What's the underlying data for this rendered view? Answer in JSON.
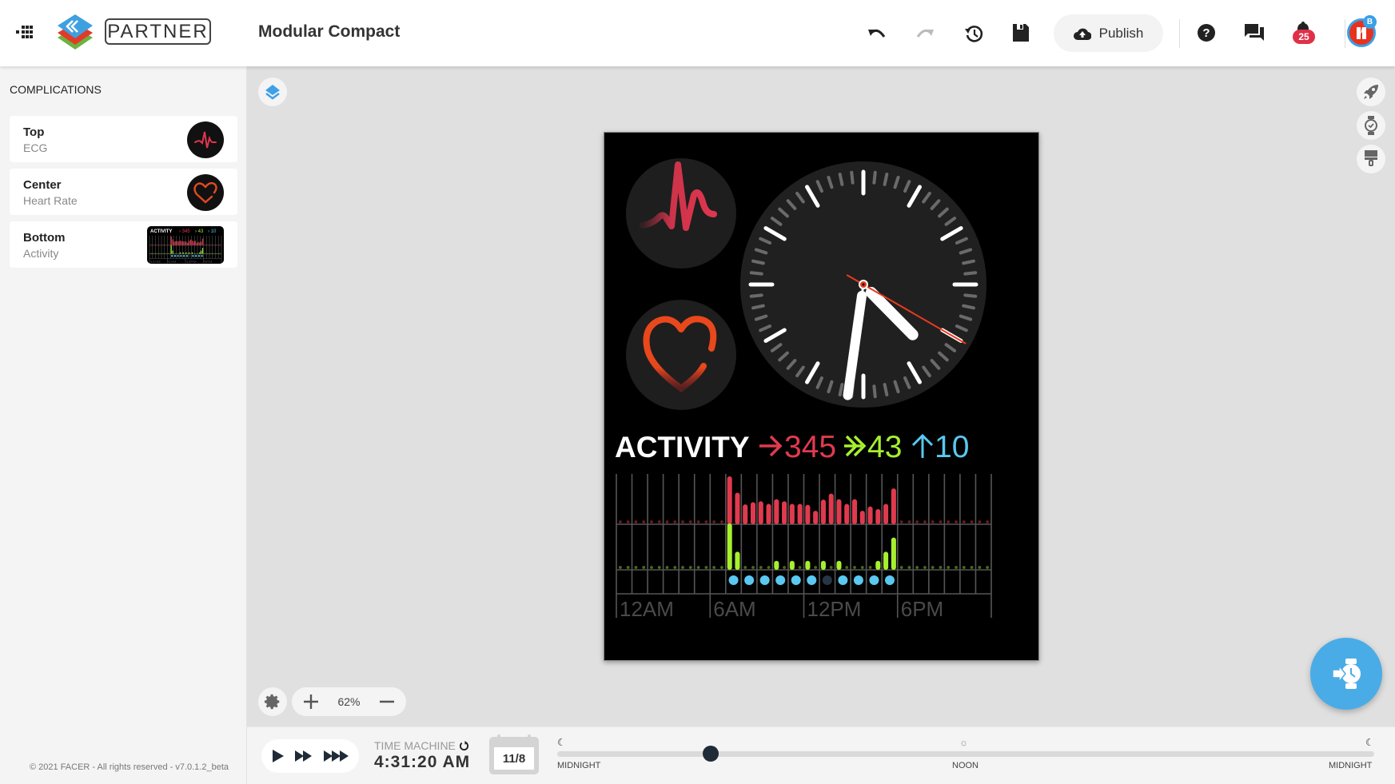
{
  "header": {
    "brand_badge": "PARTNER",
    "title": "Modular Compact",
    "publish_label": "Publish",
    "notification_count": "25",
    "avatar_badge": "B"
  },
  "sidebar": {
    "title": "COMPLICATIONS",
    "items": [
      {
        "slot": "Top",
        "type": "ECG"
      },
      {
        "slot": "Center",
        "type": "Heart Rate"
      },
      {
        "slot": "Bottom",
        "type": "Activity"
      }
    ],
    "footer": "© 2021 FACER - All rights reserved - v7.0.1.2_beta"
  },
  "canvas": {
    "zoom_level": "62%"
  },
  "watch_face": {
    "time": {
      "hour": 4,
      "minute": 31,
      "second": 20
    },
    "activity": {
      "label": "ACTIVITY",
      "move": "345",
      "exercise": "43",
      "stand": "10",
      "colors": {
        "move": "#e03a4e",
        "exercise": "#a6f02e",
        "stand": "#5ac8f0"
      },
      "hour_labels": [
        "12AM",
        "6AM",
        "12PM",
        "6PM"
      ],
      "move_bars": [
        0,
        0,
        0,
        0,
        0,
        0,
        0,
        0,
        0,
        0,
        0,
        0,
        0,
        0,
        1.0,
        0.62,
        0.35,
        0.4,
        0.42,
        0.36,
        0.47,
        0.42,
        0.36,
        0.36,
        0.34,
        0.2,
        0.46,
        0.6,
        0.47,
        0.36,
        0.47,
        0.2,
        0.3,
        0.24,
        0.36,
        0.72,
        0,
        0,
        0,
        0,
        0,
        0,
        0,
        0,
        0,
        0,
        0,
        0
      ],
      "exercise_bars": [
        0,
        0,
        0,
        0,
        0,
        0,
        0,
        0,
        0,
        0,
        0,
        0,
        0,
        0,
        1.0,
        0.32,
        0,
        0,
        0,
        0,
        0.1,
        0,
        0.1,
        0,
        0.1,
        0,
        0.1,
        0,
        0.1,
        0,
        0,
        0,
        0,
        0.1,
        0.32,
        0.66,
        0,
        0,
        0,
        0,
        0,
        0,
        0,
        0,
        0,
        0,
        0,
        0
      ],
      "stand_hours": [
        0,
        0,
        0,
        0,
        0,
        0,
        0,
        1,
        1,
        1,
        1,
        1,
        1,
        0.5,
        1,
        1,
        1,
        1,
        0,
        0,
        0,
        0,
        0,
        0
      ]
    }
  },
  "time_machine": {
    "label": "TIME MACHINE",
    "time": "4:31:20 AM",
    "date": "11/8",
    "day_fraction": 0.188,
    "labels": {
      "start": "MIDNIGHT",
      "middle": "NOON",
      "end": "MIDNIGHT"
    }
  }
}
